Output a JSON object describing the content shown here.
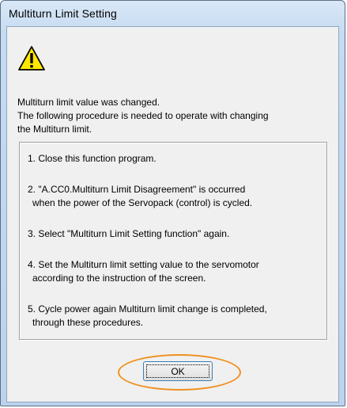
{
  "window": {
    "title": "Multiturn Limit Setting"
  },
  "icon": {
    "name": "warning-icon",
    "color": "#ffe800"
  },
  "message": {
    "line1": "Multiturn limit value was changed.",
    "line2": "The following procedure is needed to operate with changing",
    "line3": "the Multiturn limit."
  },
  "steps": {
    "s1": "1. Close this function program.",
    "s2a": "2. \"A.CC0.Multiturn Limit Disagreement\" is occurred",
    "s2b": "when the power of the Servopack (control) is cycled.",
    "s3": "3. Select  \"Multiturn Limit Setting function\" again.",
    "s4a": "4. Set the Multiturn limit setting value to the servomotor",
    "s4b": "according to the instruction of the screen.",
    "s5a": "5. Cycle power again Multiturn limit change is completed,",
    "s5b": "through these procedures."
  },
  "buttons": {
    "ok_label": "OK"
  },
  "colors": {
    "highlight": "#f0901e"
  }
}
